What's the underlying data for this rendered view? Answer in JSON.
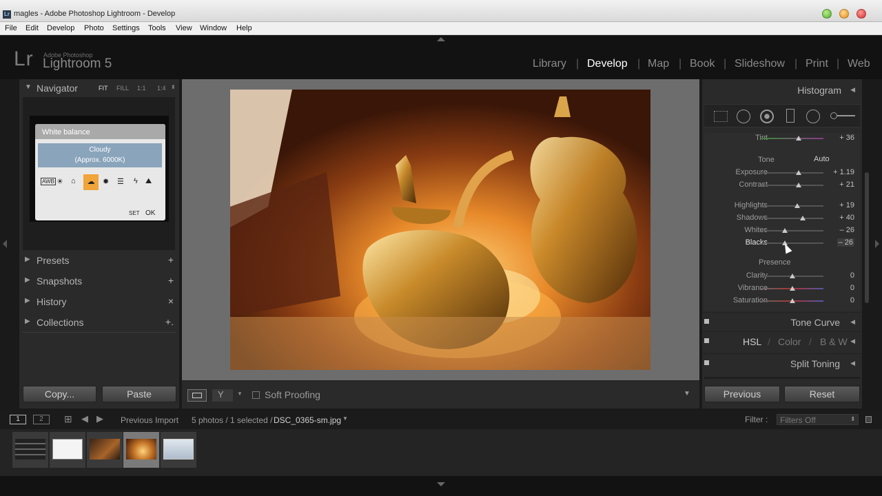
{
  "titlebar": {
    "app_badge": "Lr",
    "title": "magles - Adobe Photoshop Lightroom - Develop"
  },
  "menu": [
    "File",
    "Edit",
    "Develop",
    "Photo",
    "Settings",
    "Tools",
    "View",
    "Window",
    "Help"
  ],
  "identity": {
    "logo": "Lr",
    "brand_small": "Adobe Photoshop",
    "brand_large": "Lightroom 5"
  },
  "modules": [
    "Library",
    "Develop",
    "Map",
    "Book",
    "Slideshow",
    "Print",
    "Web"
  ],
  "active_module": "Develop",
  "navigator": {
    "title": "Navigator",
    "zoom": [
      "FIT",
      "FILL",
      "1:1",
      "1:4"
    ],
    "preview": {
      "heading": "White balance",
      "mode": "Cloudy",
      "detail": "(Approx. 6000K)",
      "awb": "AWB",
      "set": "SET",
      "ok": "OK"
    }
  },
  "left_panels": [
    {
      "label": "Presets",
      "action": "+"
    },
    {
      "label": "Snapshots",
      "action": "+"
    },
    {
      "label": "History",
      "action": "×"
    },
    {
      "label": "Collections",
      "action": "+."
    }
  ],
  "left_buttons": {
    "copy": "Copy...",
    "paste": "Paste"
  },
  "toolbar": {
    "soft_proofing": "Soft Proofing"
  },
  "right": {
    "histogram": "Histogram",
    "tint": {
      "label": "Tint",
      "value": "+ 36",
      "pos": 0.6
    },
    "tone_label": "Tone",
    "auto": "Auto",
    "tone_sliders": [
      {
        "label": "Exposure",
        "value": "+ 1.19",
        "pos": 0.6
      },
      {
        "label": "Contrast",
        "value": "+ 21",
        "pos": 0.6
      }
    ],
    "tone_sliders2": [
      {
        "label": "Highlights",
        "value": "+ 19",
        "pos": 0.58
      },
      {
        "label": "Shadows",
        "value": "+ 40",
        "pos": 0.67
      },
      {
        "label": "Whites",
        "value": "– 26",
        "pos": 0.38
      },
      {
        "label": "Blacks",
        "value": "– 26",
        "pos": 0.38
      }
    ],
    "presence_label": "Presence",
    "presence_sliders": [
      {
        "label": "Clarity",
        "value": "0",
        "pos": 0.5
      },
      {
        "label": "Vibrance",
        "value": "0",
        "pos": 0.5
      },
      {
        "label": "Saturation",
        "value": "0",
        "pos": 0.5
      }
    ],
    "tone_curve": "Tone Curve",
    "hsl": [
      "HSL",
      "Color",
      "B & W"
    ],
    "split_toning": "Split Toning",
    "previous": "Previous",
    "reset": "Reset"
  },
  "filmbar": {
    "page1": "1",
    "page2": "2",
    "source": "Previous Import",
    "count": "5 photos / 1 selected /",
    "filename": "DSC_0365-sm.jpg",
    "filter_label": "Filter :",
    "filter_value": "Filters Off"
  },
  "colors": {
    "accent": "#c8c8c8",
    "panel": "#2a2a2a",
    "active_tab": "#ffffff"
  }
}
